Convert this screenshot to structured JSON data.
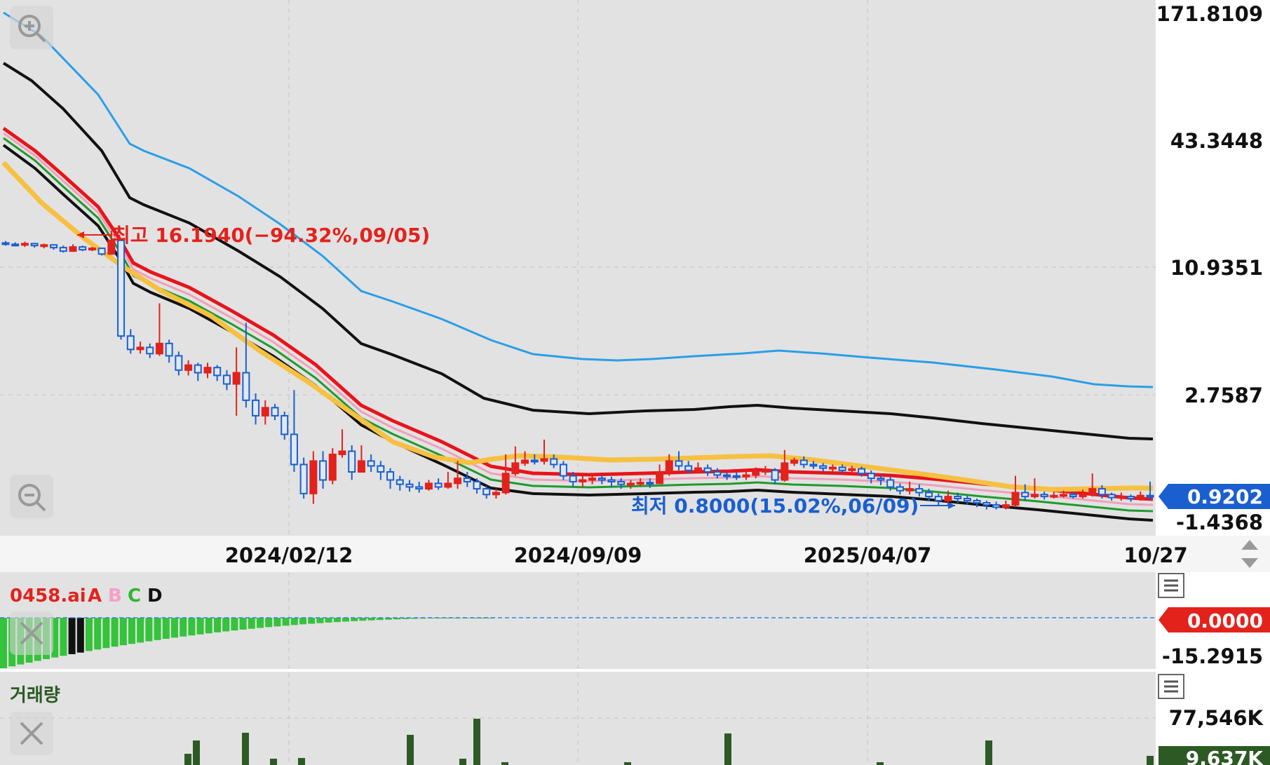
{
  "colors": {
    "up": "#e3221c",
    "down": "#1a5fcf",
    "ma_orange": "#f7c040",
    "ma_red": "#e8141c",
    "ma_green": "#1f9a2f",
    "ma_black": "#111111",
    "band_blue": "#2a9ee8",
    "vol_bar": "#2d5a24",
    "osc_bar": "#34c33b",
    "panel_bg": "#e2e2e2"
  },
  "price_axis": {
    "labels": [
      "171.8109",
      "43.3448",
      "10.9351",
      "2.7587",
      "-1.4368"
    ],
    "current_price": "0.9202"
  },
  "date_axis": {
    "labels": [
      "2024/02/12",
      "2024/09/09",
      "2025/04/07",
      "10/27"
    ]
  },
  "annotations": {
    "high": "최고 16.1940(−94.32%,09/05)",
    "low": "최저 0.8000(15.02%,06/09)"
  },
  "indicator": {
    "name": "0458.ai",
    "lines": [
      "A",
      "B",
      "C",
      "D"
    ],
    "line_colors": [
      "#e3221c",
      "#f3a0c8",
      "#2fb52f",
      "#111111"
    ],
    "value_tag": "0.0000",
    "axis_label": "-15.2915"
  },
  "volume": {
    "title": "거래량",
    "axis_label": "77,546K",
    "current_tag": "9.637K"
  },
  "icons": {
    "zoom_in": "zoom-in-icon",
    "zoom_out": "zoom-out-icon",
    "menu": "menu-icon",
    "close": "close-icon",
    "scroll": "up-down-arrows-icon"
  },
  "chart_data": {
    "type": "candlestick",
    "title": "",
    "y_scale": "log",
    "x_ticks": [
      "2024/02/12",
      "2024/09/09",
      "2025/04/07",
      "10/27"
    ],
    "y_ticks": [
      171.8109,
      43.3448,
      10.9351,
      2.7587
    ],
    "high": {
      "value": 16.194,
      "label": "최고 16.1940(−94.32%,09/05)"
    },
    "low": {
      "value": 0.8,
      "label": "최저 0.8000(15.02%,06/09)"
    },
    "last_close": 0.9202,
    "candles": [
      [
        14.2,
        14.0,
        14.5,
        13.8
      ],
      [
        14.0,
        13.9,
        14.3,
        13.7
      ],
      [
        13.9,
        14.1,
        14.4,
        13.6
      ],
      [
        14.1,
        13.8,
        14.2,
        13.5
      ],
      [
        13.8,
        13.9,
        14.1,
        13.4
      ],
      [
        13.9,
        13.5,
        14.0,
        13.2
      ],
      [
        13.5,
        13.0,
        13.8,
        12.8
      ],
      [
        13.0,
        13.6,
        14.0,
        12.9
      ],
      [
        13.6,
        13.2,
        13.8,
        13.0
      ],
      [
        13.2,
        13.4,
        13.6,
        13.0
      ],
      [
        13.4,
        12.6,
        13.5,
        12.4
      ],
      [
        12.6,
        14.6,
        16.19,
        12.5
      ],
      [
        14.6,
        5.2,
        14.9,
        5.0
      ],
      [
        5.2,
        4.5,
        5.6,
        4.3
      ],
      [
        4.5,
        4.6,
        4.9,
        4.3
      ],
      [
        4.6,
        4.3,
        4.8,
        4.1
      ],
      [
        4.3,
        4.8,
        7.4,
        4.2
      ],
      [
        4.8,
        4.2,
        5.0,
        3.9
      ],
      [
        4.2,
        3.6,
        4.4,
        3.4
      ],
      [
        3.6,
        3.8,
        4.0,
        3.4
      ],
      [
        3.8,
        3.5,
        3.9,
        3.2
      ],
      [
        3.5,
        3.7,
        3.9,
        3.3
      ],
      [
        3.7,
        3.4,
        3.8,
        3.2
      ],
      [
        3.4,
        3.1,
        3.6,
        2.9
      ],
      [
        3.1,
        3.5,
        4.6,
        2.2
      ],
      [
        3.5,
        2.6,
        6.0,
        2.4
      ],
      [
        2.6,
        2.2,
        2.8,
        2.0
      ],
      [
        2.2,
        2.4,
        2.6,
        2.0
      ],
      [
        2.4,
        2.2,
        2.5,
        2.1
      ],
      [
        2.2,
        1.8,
        2.3,
        1.7
      ],
      [
        1.8,
        1.3,
        2.9,
        1.2
      ],
      [
        1.3,
        0.95,
        1.4,
        0.9
      ],
      [
        0.95,
        1.35,
        1.5,
        0.85
      ],
      [
        1.35,
        1.1,
        1.5,
        1.0
      ],
      [
        1.1,
        1.45,
        1.55,
        1.05
      ],
      [
        1.45,
        1.5,
        1.9,
        1.4
      ],
      [
        1.5,
        1.2,
        1.6,
        1.1
      ],
      [
        1.2,
        1.35,
        1.6,
        1.2
      ],
      [
        1.35,
        1.28,
        1.45,
        1.2
      ],
      [
        1.28,
        1.2,
        1.35,
        1.1
      ],
      [
        1.2,
        1.1,
        1.25,
        1.0
      ],
      [
        1.1,
        1.05,
        1.15,
        0.98
      ],
      [
        1.05,
        1.02,
        1.1,
        0.97
      ],
      [
        1.02,
        1.0,
        1.08,
        0.96
      ],
      [
        1.0,
        1.06,
        1.1,
        0.98
      ],
      [
        1.06,
        1.02,
        1.12,
        0.99
      ],
      [
        1.02,
        1.06,
        1.2,
        1.0
      ],
      [
        1.06,
        1.12,
        1.35,
        1.0
      ],
      [
        1.12,
        1.08,
        1.2,
        1.02
      ],
      [
        1.08,
        1.0,
        1.12,
        0.95
      ],
      [
        1.0,
        0.94,
        1.03,
        0.9
      ],
      [
        0.94,
        0.96,
        1.0,
        0.9
      ],
      [
        0.96,
        1.18,
        1.45,
        0.94
      ],
      [
        1.18,
        1.32,
        1.58,
        1.15
      ],
      [
        1.32,
        1.36,
        1.5,
        1.28
      ],
      [
        1.36,
        1.35,
        1.45,
        1.3
      ],
      [
        1.35,
        1.38,
        1.7,
        1.3
      ],
      [
        1.38,
        1.3,
        1.45,
        1.25
      ],
      [
        1.3,
        1.15,
        1.35,
        1.1
      ],
      [
        1.15,
        1.08,
        1.2,
        1.02
      ],
      [
        1.08,
        1.1,
        1.15,
        1.02
      ],
      [
        1.1,
        1.12,
        1.18,
        1.05
      ],
      [
        1.12,
        1.1,
        1.16,
        1.05
      ],
      [
        1.1,
        1.08,
        1.14,
        1.02
      ],
      [
        1.08,
        1.05,
        1.12,
        1.0
      ],
      [
        1.05,
        1.06,
        1.1,
        1.0
      ],
      [
        1.06,
        1.07,
        1.12,
        1.02
      ],
      [
        1.07,
        1.06,
        1.12,
        1.01
      ],
      [
        1.06,
        1.2,
        1.3,
        1.05
      ],
      [
        1.2,
        1.35,
        1.45,
        1.15
      ],
      [
        1.35,
        1.28,
        1.5,
        1.22
      ],
      [
        1.28,
        1.22,
        1.35,
        1.18
      ],
      [
        1.22,
        1.25,
        1.33,
        1.18
      ],
      [
        1.25,
        1.2,
        1.3,
        1.15
      ],
      [
        1.2,
        1.16,
        1.25,
        1.12
      ],
      [
        1.16,
        1.15,
        1.2,
        1.1
      ],
      [
        1.15,
        1.14,
        1.2,
        1.1
      ],
      [
        1.14,
        1.16,
        1.22,
        1.1
      ],
      [
        1.16,
        1.2,
        1.26,
        1.12
      ],
      [
        1.2,
        1.22,
        1.28,
        1.16
      ],
      [
        1.22,
        1.1,
        1.25,
        1.05
      ],
      [
        1.1,
        1.32,
        1.52,
        1.08
      ],
      [
        1.32,
        1.36,
        1.4,
        1.28
      ],
      [
        1.36,
        1.3,
        1.42,
        1.25
      ],
      [
        1.3,
        1.28,
        1.35,
        1.24
      ],
      [
        1.28,
        1.25,
        1.32,
        1.2
      ],
      [
        1.25,
        1.26,
        1.3,
        1.2
      ],
      [
        1.26,
        1.22,
        1.3,
        1.18
      ],
      [
        1.22,
        1.24,
        1.28,
        1.18
      ],
      [
        1.24,
        1.18,
        1.27,
        1.14
      ],
      [
        1.18,
        1.12,
        1.22,
        1.06
      ],
      [
        1.12,
        1.1,
        1.16,
        1.04
      ],
      [
        1.1,
        1.02,
        1.14,
        0.98
      ],
      [
        1.02,
        0.98,
        1.06,
        0.94
      ],
      [
        0.98,
        1.0,
        1.08,
        0.94
      ],
      [
        1.0,
        0.96,
        1.05,
        0.92
      ],
      [
        0.96,
        0.92,
        1.0,
        0.88
      ],
      [
        0.92,
        0.88,
        0.95,
        0.84
      ],
      [
        0.88,
        0.92,
        0.98,
        0.84
      ],
      [
        0.92,
        0.9,
        0.96,
        0.86
      ],
      [
        0.9,
        0.88,
        0.93,
        0.84
      ],
      [
        0.88,
        0.86,
        0.9,
        0.82
      ],
      [
        0.86,
        0.84,
        0.88,
        0.8
      ],
      [
        0.84,
        0.82,
        0.87,
        0.8
      ],
      [
        0.82,
        0.84,
        0.88,
        0.8
      ],
      [
        0.84,
        0.96,
        1.15,
        0.82
      ],
      [
        0.96,
        0.92,
        1.05,
        0.88
      ],
      [
        0.92,
        0.94,
        1.12,
        0.9
      ],
      [
        0.94,
        0.92,
        0.97,
        0.89
      ],
      [
        0.92,
        0.93,
        0.97,
        0.9
      ],
      [
        0.93,
        0.94,
        0.98,
        0.91
      ],
      [
        0.94,
        0.92,
        0.97,
        0.9
      ],
      [
        0.92,
        0.94,
        0.99,
        0.9
      ],
      [
        0.94,
        1.0,
        1.18,
        0.92
      ],
      [
        1.0,
        0.94,
        1.04,
        0.9
      ],
      [
        0.94,
        0.91,
        0.96,
        0.88
      ],
      [
        0.91,
        0.92,
        0.96,
        0.88
      ],
      [
        0.92,
        0.9,
        0.94,
        0.87
      ],
      [
        0.9,
        0.93,
        0.97,
        0.88
      ],
      [
        0.93,
        0.92,
        1.08,
        0.88
      ]
    ],
    "volume_max_label": "77,546K",
    "volume_last": "9.637K",
    "indicator_axis_label": "-15.2915",
    "indicator_last": "0.0000"
  }
}
